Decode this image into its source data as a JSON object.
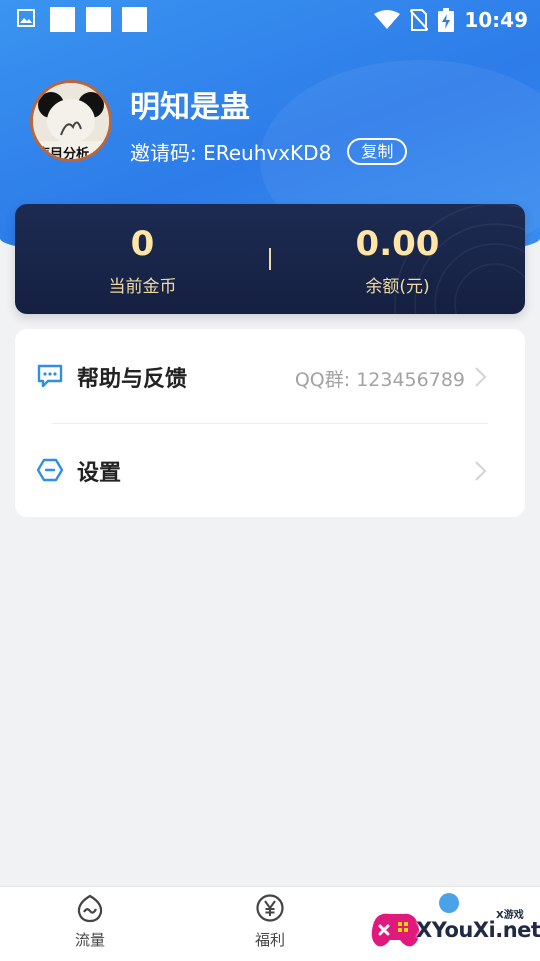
{
  "status_bar": {
    "time": "10:49",
    "icons": [
      "image-icon",
      "wifi-icon",
      "no-sim-icon",
      "battery-charging-icon"
    ]
  },
  "profile": {
    "name": "明知是蛊",
    "invite_label": "邀请码: EReuhvxKD8",
    "copy_label": "复制",
    "avatar_text": "盲目分析"
  },
  "stats": {
    "coins_value": "0",
    "coins_label": "当前金币",
    "balance_value": "0.00",
    "balance_label": "余额(元)"
  },
  "menu": {
    "help_label": "帮助与反馈",
    "help_value": "QQ群: 123456789",
    "settings_label": "设置"
  },
  "nav": {
    "items": [
      {
        "label": "流量",
        "icon": "flow-icon"
      },
      {
        "label": "福利",
        "icon": "yen-icon"
      }
    ]
  },
  "watermark": {
    "text": "XYouXi.net",
    "sub": "X游戏"
  },
  "colors": {
    "header_blue": "#2d7ce9",
    "card_dark": "#1d2b52",
    "gold": "#ffe6a6",
    "icon_blue": "#2f8ee5"
  }
}
